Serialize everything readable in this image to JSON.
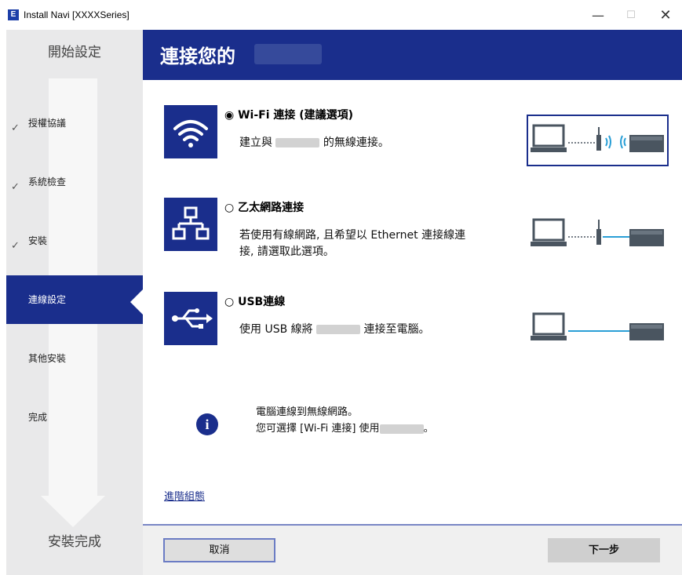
{
  "window": {
    "icon_letter": "E",
    "title": "Install Navi [XXXXSeries]",
    "minimize": "—",
    "maximize": "☐",
    "close": "✕"
  },
  "sidebar": {
    "top_title": "開始設定",
    "bottom_title": "安裝完成",
    "steps": [
      {
        "label": "授權協議",
        "done": true
      },
      {
        "label": "系統檢查",
        "done": true
      },
      {
        "label": "安裝",
        "done": true
      },
      {
        "label": "連線設定",
        "done": false,
        "active": true
      },
      {
        "label": "其他安裝",
        "done": false
      },
      {
        "label": "完成",
        "done": false
      }
    ],
    "check_glyph": "✓"
  },
  "header": {
    "title": "連接您的"
  },
  "options": [
    {
      "icon": "wifi-icon",
      "radio": "◉",
      "title": "Wi-Fi 連接 (建議選項)",
      "desc_before": "建立與",
      "desc_after": "的無線連接。"
    },
    {
      "icon": "network-icon",
      "radio": "○",
      "title": "乙太網路連接",
      "desc_line1": "若使用有線網路, 且希望以 Ethernet  連接線連",
      "desc_line2": "接, 請選取此選項。"
    },
    {
      "icon": "usb-icon",
      "radio": "○",
      "title": "USB連線",
      "desc_before": "使用 USB 線將",
      "desc_after": "連接至電腦。"
    }
  ],
  "info": {
    "icon": "info-icon",
    "glyph": "i",
    "line1": "電腦連線到無線網路。",
    "line2_before": "您可選擇 [Wi-Fi 連接] 使用",
    "line2_after": "。"
  },
  "advanced_link": "進階組態",
  "buttons": {
    "cancel": "取消",
    "next": "下一步"
  },
  "colors": {
    "brand_blue": "#1a2e8c",
    "sidebar_bg": "#e9e9ea",
    "illus_blue": "#2a9fd6"
  }
}
